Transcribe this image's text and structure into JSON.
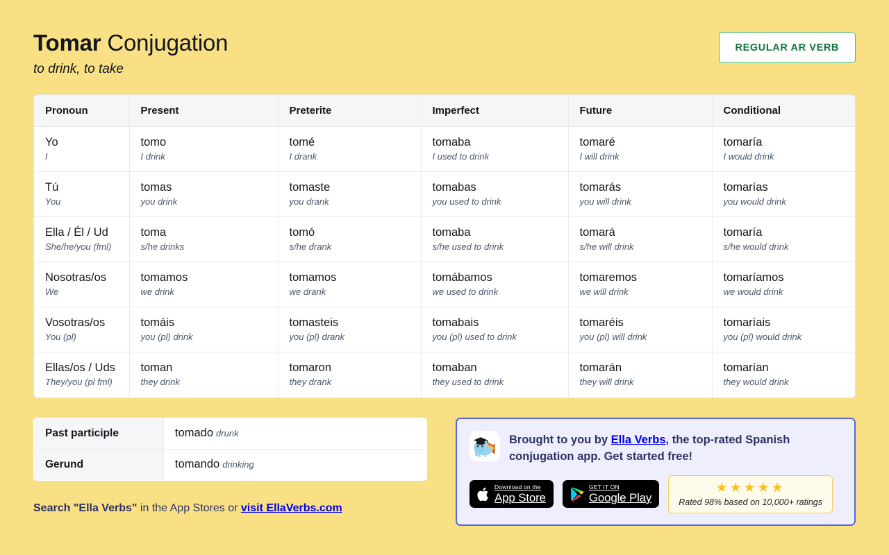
{
  "header": {
    "verb": "Tomar",
    "title_suffix": " Conjugation",
    "subtitle": "to drink, to take",
    "badge": "REGULAR AR VERB"
  },
  "table": {
    "columns": [
      "Pronoun",
      "Present",
      "Preterite",
      "Imperfect",
      "Future",
      "Conditional"
    ],
    "rows": [
      {
        "pronoun": "Yo",
        "pronoun_tr": "I",
        "present": "tomo",
        "present_tr": "I drink",
        "preterite": "tomé",
        "preterite_tr": "I drank",
        "imperfect": "tomaba",
        "imperfect_tr": "I used to drink",
        "future": "tomaré",
        "future_tr": "I will drink",
        "conditional": "tomaría",
        "conditional_tr": "I would drink"
      },
      {
        "pronoun": "Tú",
        "pronoun_tr": "You",
        "present": "tomas",
        "present_tr": "you drink",
        "preterite": "tomaste",
        "preterite_tr": "you drank",
        "imperfect": "tomabas",
        "imperfect_tr": "you used to drink",
        "future": "tomarás",
        "future_tr": "you will drink",
        "conditional": "tomarías",
        "conditional_tr": "you would drink"
      },
      {
        "pronoun": "Ella / Él / Ud",
        "pronoun_tr": "She/he/you (fml)",
        "present": "toma",
        "present_tr": "s/he drinks",
        "preterite": "tomó",
        "preterite_tr": "s/he drank",
        "imperfect": "tomaba",
        "imperfect_tr": "s/he used to drink",
        "future": "tomará",
        "future_tr": "s/he will drink",
        "conditional": "tomaría",
        "conditional_tr": "s/he would drink"
      },
      {
        "pronoun": "Nosotras/os",
        "pronoun_tr": "We",
        "present": "tomamos",
        "present_tr": "we drink",
        "preterite": "tomamos",
        "preterite_tr": "we drank",
        "imperfect": "tomábamos",
        "imperfect_tr": "we used to drink",
        "future": "tomaremos",
        "future_tr": "we will drink",
        "conditional": "tomaríamos",
        "conditional_tr": "we would drink"
      },
      {
        "pronoun": "Vosotras/os",
        "pronoun_tr": "You (pl)",
        "present": "tomáis",
        "present_tr": "you (pl) drink",
        "preterite": "tomasteis",
        "preterite_tr": "you (pl) drank",
        "imperfect": "tomabais",
        "imperfect_tr": "you (pl) used to drink",
        "future": "tomaréis",
        "future_tr": "you (pl) will drink",
        "conditional": "tomaríais",
        "conditional_tr": "you (pl) would drink"
      },
      {
        "pronoun": "Ellas/os / Uds",
        "pronoun_tr": "They/you (pl fml)",
        "present": "toman",
        "present_tr": "they drink",
        "preterite": "tomaron",
        "preterite_tr": "they drank",
        "imperfect": "tomaban",
        "imperfect_tr": "they used to drink",
        "future": "tomarán",
        "future_tr": "they will drink",
        "conditional": "tomarían",
        "conditional_tr": "they would drink"
      }
    ]
  },
  "forms": {
    "past_participle_label": "Past participle",
    "past_participle_value": "tomado",
    "past_participle_tr": "drunk",
    "gerund_label": "Gerund",
    "gerund_value": "tomando",
    "gerund_tr": "drinking"
  },
  "search_line": {
    "bold_1": "Search \"Ella Verbs\"",
    "plain": " in the App Stores or ",
    "link": "visit EllaVerbs.com"
  },
  "promo": {
    "text_1": "Brought to you by ",
    "link": "Ella Verbs",
    "text_2": ", the top-rated Spanish conjugation app. Get started free!",
    "app_store_small": "Download on the",
    "app_store_big": "App Store",
    "google_play_small": "GET IT ON",
    "google_play_big": "Google Play",
    "stars": "★★★★★",
    "rating_text": "Rated 98% based on 10,000+ ratings"
  },
  "colors": {
    "page_background": "#f9e084",
    "badge_border": "#4cb96b",
    "badge_text": "#14733c",
    "promo_border": "#5566dd",
    "promo_background": "#eeeefc",
    "promo_text": "#2b3266",
    "star_gold": "#fcbf1e"
  }
}
